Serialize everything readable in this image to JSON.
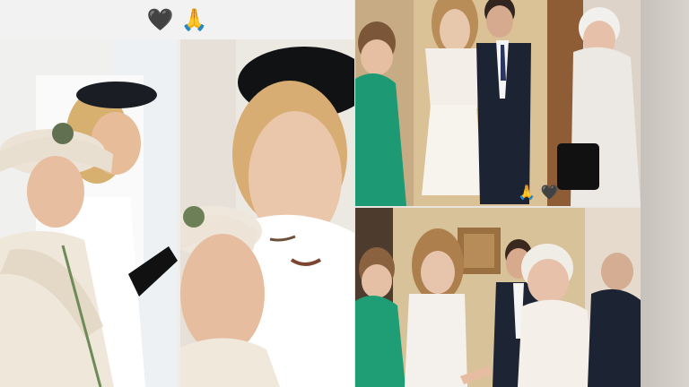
{
  "overlay": {
    "top_emojis": [
      "🖤",
      "🙏"
    ],
    "inline_emojis": [
      "🙏",
      "🖤"
    ]
  },
  "colors": {
    "background": "#e8e4e0",
    "accent_green": "#1f9e76",
    "dark_suit": "#1d2433",
    "cream": "#f4f1ec"
  },
  "icons": [
    "black-heart-icon",
    "praying-hands-icon"
  ]
}
